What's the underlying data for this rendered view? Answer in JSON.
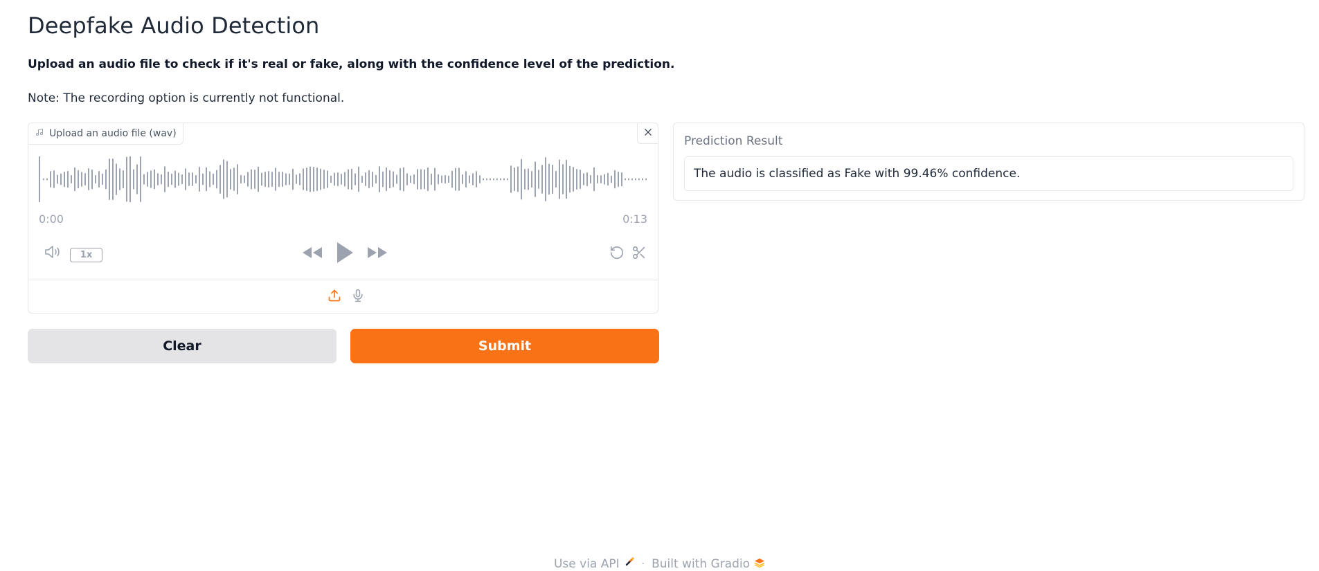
{
  "header": {
    "title": "Deepfake Audio Detection",
    "subtitle": "Upload an audio file to check if it's real or fake, along with the confidence level of the prediction.",
    "note": "Note: The recording option is currently not functional."
  },
  "audio_input": {
    "label": "Upload an audio file (wav)",
    "label_icon": "music-note-icon",
    "time_start": "0:00",
    "time_end": "0:13",
    "playback_speed": "1x",
    "icons": [
      "close-icon",
      "volume-icon",
      "rewind-icon",
      "play-icon",
      "fast-forward-icon",
      "reset-icon",
      "trim-icon",
      "upload-icon",
      "microphone-icon"
    ]
  },
  "buttons": {
    "clear": "Clear",
    "submit": "Submit"
  },
  "output": {
    "label": "Prediction Result",
    "value": "The audio is classified as Fake with 99.46% confidence."
  },
  "footer": {
    "api_link": "Use via API",
    "separator": "·",
    "built_with": "Built with Gradio"
  },
  "colors": {
    "accent": "#f97316",
    "clear_bg": "#e4e4e7",
    "muted_text": "#9ca3af",
    "waveform": "#9ca3af"
  }
}
